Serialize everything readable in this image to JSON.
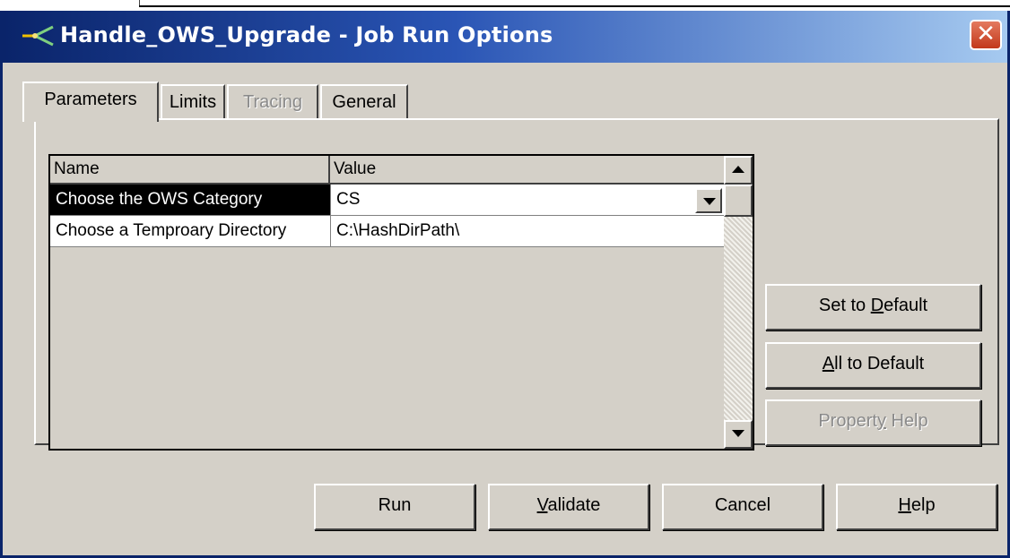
{
  "window": {
    "title": "Handle_OWS_Upgrade - Job Run Options",
    "close_glyph": "✕"
  },
  "tabs": [
    {
      "label": "Parameters",
      "state": "active"
    },
    {
      "label": "Limits",
      "state": "normal"
    },
    {
      "label": "Tracing",
      "state": "disabled"
    },
    {
      "label": "General",
      "state": "normal"
    }
  ],
  "grid": {
    "columns": [
      "Name",
      "Value"
    ],
    "rows": [
      {
        "name": "Choose the OWS Category",
        "value": "CS",
        "selected": true,
        "has_dropdown": true
      },
      {
        "name": "Choose a Temproary Directory",
        "value": "C:\\HashDirPath\\",
        "selected": false,
        "has_dropdown": false
      }
    ]
  },
  "side_buttons": {
    "set_default": {
      "pre": "Set to ",
      "u": "D",
      "post": "efault"
    },
    "all_default": {
      "pre": "",
      "u": "A",
      "post": "ll to Default"
    },
    "property_help": {
      "pre": "Propert",
      "u": "y",
      "post": " Help",
      "disabled": true
    }
  },
  "bottom_buttons": {
    "run": {
      "pre": "Run",
      "u": "",
      "post": ""
    },
    "validate": {
      "pre": "",
      "u": "V",
      "post": "alidate"
    },
    "cancel": {
      "pre": "Cancel",
      "u": "",
      "post": ""
    },
    "help": {
      "pre": "",
      "u": "H",
      "post": "elp"
    }
  },
  "icons": {
    "app": "datastage-job-icon",
    "close": "close-icon",
    "dropdown": "chevron-down-icon",
    "scroll_up": "arrow-up-icon",
    "scroll_down": "arrow-down-icon"
  },
  "colors": {
    "titlebar_start": "#0a246a",
    "titlebar_end": "#a6caf0",
    "dialog_face": "#d4d0c8",
    "selection": "#000000",
    "close_button": "#c2381b"
  }
}
